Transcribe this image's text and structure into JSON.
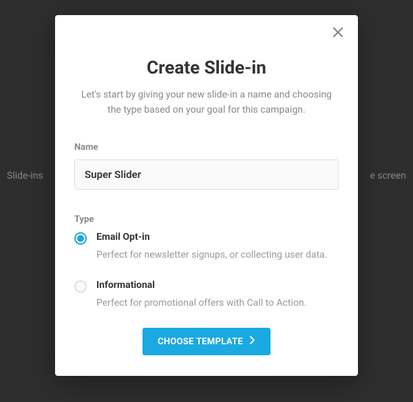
{
  "backdrop": {
    "hint_left": "Slide-ins",
    "hint_right": "e screen"
  },
  "modal": {
    "title": "Create Slide-in",
    "subtitle": "Let's start by giving your new slide-in a name and choosing the type based on your goal for this campaign.",
    "name_field": {
      "label": "Name",
      "value": "Super Slider"
    },
    "type_field": {
      "label": "Type",
      "options": [
        {
          "id": "email-optin",
          "label": "Email Opt-in",
          "description": "Perfect for newsletter signups, or collecting user data.",
          "selected": true
        },
        {
          "id": "informational",
          "label": "Informational",
          "description": "Perfect for promotional offers with Call to Action.",
          "selected": false
        }
      ]
    },
    "primary_action": "CHOOSE TEMPLATE"
  },
  "colors": {
    "accent": "#1aa9e1",
    "backdrop": "#2e2e2e"
  }
}
